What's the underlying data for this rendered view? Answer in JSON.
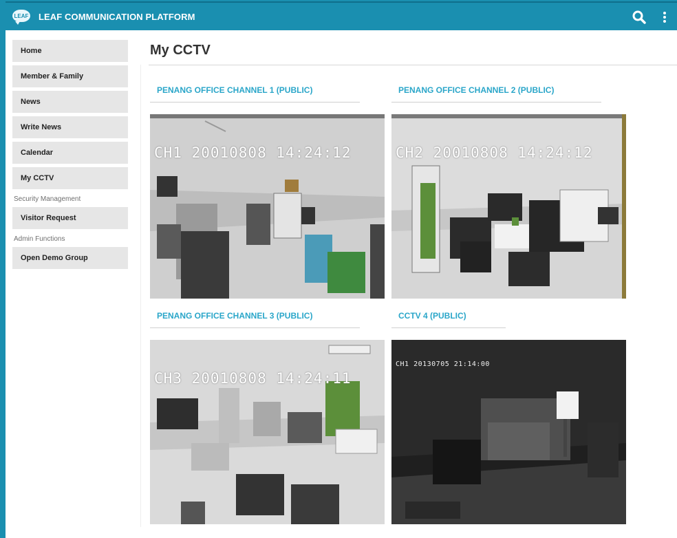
{
  "app": {
    "title": "LEAF COMMUNICATION PLATFORM",
    "logo_text": "LEAF"
  },
  "header": {
    "search_icon": "search-icon",
    "more_icon": "more-vertical-icon"
  },
  "sidebar": {
    "items": [
      {
        "label": "Home"
      },
      {
        "label": "Member & Family"
      },
      {
        "label": "News"
      },
      {
        "label": "Write News"
      },
      {
        "label": "Calendar"
      },
      {
        "label": "My CCTV"
      }
    ],
    "security": {
      "label": "Security Management",
      "items": [
        {
          "label": "Visitor Request"
        }
      ]
    },
    "admin": {
      "label": "Admin Functions",
      "items": [
        {
          "label": "Open Demo Group"
        }
      ]
    }
  },
  "main": {
    "title": "My CCTV",
    "cameras": [
      {
        "title": "PENANG OFFICE CHANNEL 1 (PUBLIC)",
        "osd": "CH1 20010808 14:24:12"
      },
      {
        "title": "PENANG OFFICE CHANNEL 2 (PUBLIC)",
        "osd": "CH2 20010808 14:24:12"
      },
      {
        "title": "PENANG OFFICE CHANNEL 3 (PUBLIC)",
        "osd": "CH3 20010808 14:24:11"
      },
      {
        "title": "CCTV 4 (PUBLIC)",
        "osd": "CH1 20130705 21:14:00"
      }
    ]
  },
  "colors": {
    "brand": "#1a8fb0",
    "link": "#2aa6c9",
    "nav_bg": "#e6e6e6"
  }
}
